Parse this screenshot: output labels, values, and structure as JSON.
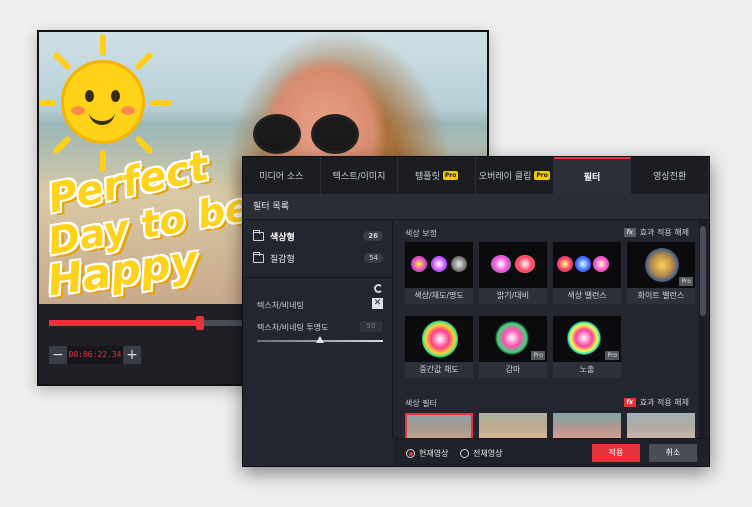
{
  "preview": {
    "promo_lines": [
      "Perfect",
      "Day to be",
      "Happy"
    ],
    "timecode": "00:06:22.34",
    "minus_label": "−",
    "plus_label": "+",
    "progress": 0.35
  },
  "tabs": [
    {
      "label": "미디어 소스",
      "pro": false,
      "active": false
    },
    {
      "label": "텍스트/이미지",
      "pro": false,
      "active": false
    },
    {
      "label": "템플릿",
      "pro": true,
      "active": false
    },
    {
      "label": "오버레이 클립",
      "pro": true,
      "active": false
    },
    {
      "label": "필터",
      "pro": false,
      "active": true
    },
    {
      "label": "영상전환",
      "pro": false,
      "active": false
    }
  ],
  "pro_badge": "Pro",
  "filter_list_title": "필터 목록",
  "categories": [
    {
      "label": "색상형",
      "count": "26"
    },
    {
      "label": "질감형",
      "count": "54"
    }
  ],
  "options": {
    "vignette_label": "텍스처/비네팅",
    "vignette_opacity_label": "텍스처/비네팅 투명도",
    "opacity_value": "50",
    "opacity_fraction": 0.5,
    "checkbox_mark": "✕"
  },
  "color_correction": {
    "title": "색상 보정",
    "reset_label": "효과 적용 해제",
    "fx_badge": "fx",
    "items": [
      {
        "label": "색상/채도/명도",
        "pro": false
      },
      {
        "label": "밝기/대비",
        "pro": false
      },
      {
        "label": "색상 밸런스",
        "pro": false
      },
      {
        "label": "화이트 밸런스",
        "pro": true
      },
      {
        "label": "중간값 채도",
        "pro": false
      },
      {
        "label": "감마",
        "pro": true
      },
      {
        "label": "노출",
        "pro": true
      }
    ]
  },
  "color_filter": {
    "title": "색상 필터",
    "reset_label": "효과 적용 해제"
  },
  "bottom": {
    "radio_current": "현재영상",
    "radio_all": "전체영상",
    "apply_label": "적용",
    "cancel_label": "취소"
  },
  "colors": {
    "accent": "#e5333c",
    "panel_bg": "#23262e",
    "pro_badge": "#f2cc00"
  }
}
